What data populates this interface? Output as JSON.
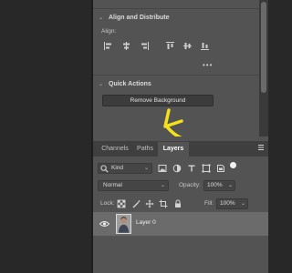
{
  "align_distribute": {
    "title": "Align and Distribute",
    "align_label": "Align:",
    "icons": [
      "align-left-edges-icon",
      "align-horizontal-centers-icon",
      "align-right-edges-icon",
      "align-top-edges-icon",
      "align-vertical-centers-icon",
      "align-bottom-edges-icon"
    ],
    "more": "•••"
  },
  "quick_actions": {
    "title": "Quick Actions",
    "remove_background_label": "Remove Background"
  },
  "annotation": {
    "arrow_color": "#f5e11a"
  },
  "layers_panel": {
    "tabs": [
      {
        "label": "Channels",
        "active": false
      },
      {
        "label": "Paths",
        "active": false
      },
      {
        "label": "Layers",
        "active": true
      }
    ],
    "filter": {
      "kind_label": "Kind",
      "icons": [
        "image-filter-icon",
        "adjustment-filter-icon",
        "type-filter-icon",
        "shape-filter-icon",
        "smart-object-filter-icon"
      ]
    },
    "blend_mode": "Normal",
    "opacity_label": "Opacity:",
    "opacity_value": "100%",
    "lock_label": "Lock:",
    "lock_icons": [
      "lock-transparent-pixels-icon",
      "lock-image-pixels-icon",
      "lock-position-icon",
      "lock-artboard-icon",
      "lock-all-icon"
    ],
    "fill_label": "Fill:",
    "fill_value": "100%",
    "layers": [
      {
        "name": "Layer 0",
        "visible": true,
        "selected": true
      }
    ]
  },
  "colors": {
    "panel_bg": "#535353",
    "button_bg": "#3c3c3c",
    "tab_bar_bg": "#3f3f3f",
    "selected_layer_bg": "#6b6b6b",
    "workspace_bg": "#282828"
  }
}
